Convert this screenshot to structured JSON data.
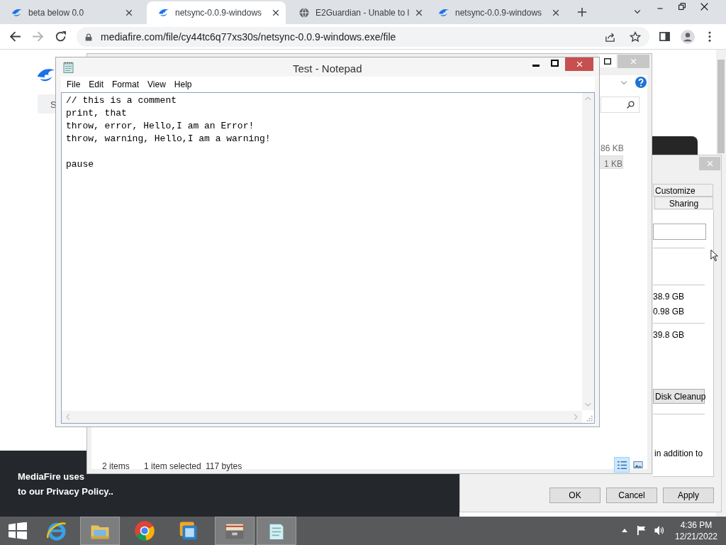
{
  "browser": {
    "tabs": [
      {
        "title": "beta below 0.0",
        "kind": "site",
        "selected": false
      },
      {
        "title": "netsync-0.0.9-windows",
        "kind": "site",
        "selected": true
      },
      {
        "title": "E2Guardian - Unable to l",
        "kind": "web",
        "selected": false
      },
      {
        "title": "netsync-0.0.9-windows",
        "kind": "site",
        "selected": false
      }
    ],
    "address": "mediafire.com/file/cy44tc6q77xs30s/netsync-0.0.9-windows.exe/file"
  },
  "web_page": {
    "side_button": "S",
    "cookie_lines": [
      "MediaFire uses",
      "to our Privacy Policy.."
    ]
  },
  "explorer": {
    "sizes": [
      {
        "text": "86 KB",
        "selected": false
      },
      {
        "text": "1 KB",
        "selected": true
      }
    ],
    "status": [
      "2 items",
      "1 item selected",
      "117 bytes"
    ]
  },
  "properties": {
    "tabs": [
      {
        "label": "Customize",
        "selected": false
      },
      {
        "label": "Sharing",
        "selected": false
      }
    ],
    "values": [
      "38.9 GB",
      "0.98 GB"
    ],
    "total": "39.8 GB",
    "cleanup": "Disk Cleanup",
    "note": "in addition to",
    "buttons": [
      "OK",
      "Cancel",
      "Apply"
    ]
  },
  "notepad": {
    "title": "Test - Notepad",
    "menu": [
      "File",
      "Edit",
      "Format",
      "View",
      "Help"
    ],
    "text": "// this is a comment\nprint, that\nthrow, error, Hello,I am an Error!\nthrow, warning, Hello,I am a warning!\n\npause"
  },
  "taskbar": {
    "apps": [
      {
        "kind": "ie",
        "open": false
      },
      {
        "kind": "folder",
        "open": true
      },
      {
        "kind": "chrome",
        "open": false
      },
      {
        "kind": "vm",
        "open": false
      },
      {
        "kind": "archive",
        "open": true
      },
      {
        "kind": "notepad",
        "open": true
      }
    ],
    "time": "4:36 PM",
    "date": "12/21/2022"
  }
}
